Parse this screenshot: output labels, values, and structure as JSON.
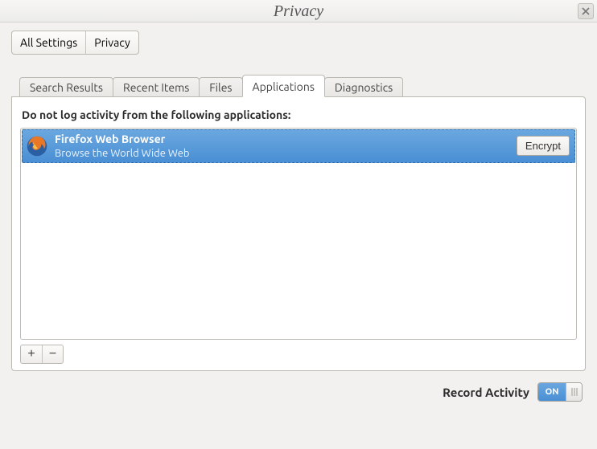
{
  "window": {
    "title": "Privacy"
  },
  "breadcrumb": {
    "all_settings": "All Settings",
    "privacy": "Privacy"
  },
  "tabs": {
    "search_results": "Search Results",
    "recent_items": "Recent Items",
    "files": "Files",
    "applications": "Applications",
    "diagnostics": "Diagnostics"
  },
  "panel": {
    "heading": "Do not log activity from the following applications:",
    "apps": [
      {
        "name": "Firefox Web Browser",
        "desc": "Browse the World Wide Web",
        "action": "Encrypt"
      }
    ]
  },
  "buttons": {
    "add": "+",
    "remove": "−"
  },
  "footer": {
    "label": "Record Activity",
    "toggle_on": "ON",
    "toggle_state": "on"
  }
}
